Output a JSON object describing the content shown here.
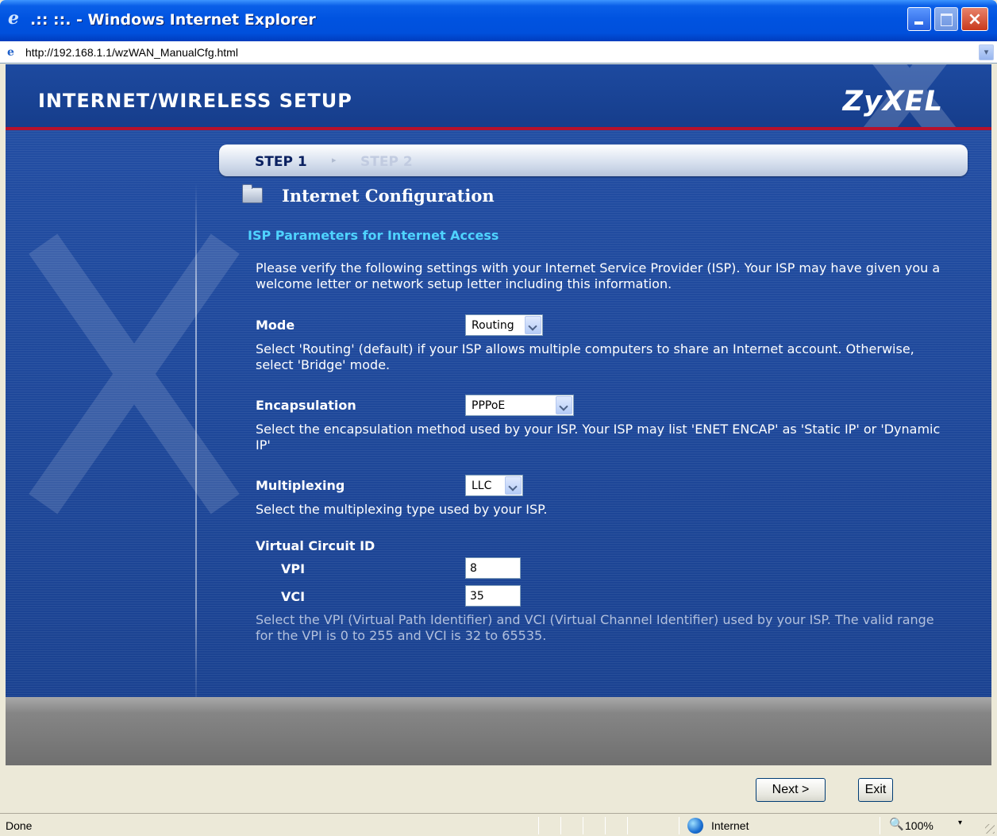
{
  "window": {
    "title": ".:: ::. - Windows Internet Explorer",
    "ie_icon": "ie-logo-icon",
    "controls": {
      "minimize": "minimize",
      "maximize": "maximize",
      "close": "×"
    }
  },
  "address": {
    "url": "http://192.168.1.1/wzWAN_ManualCfg.html",
    "icon": "page-icon"
  },
  "header": {
    "title": "INTERNET/WIRELESS SETUP",
    "brand": "ZyXEL",
    "accent_color": "#b5112c"
  },
  "steps": {
    "step1": "STEP 1",
    "arrow": "▸",
    "step2": "STEP 2"
  },
  "section": {
    "title": "Internet Configuration",
    "subtitle": "ISP Parameters for Internet Access",
    "intro": "Please verify the following settings with your Internet Service Provider (ISP). Your ISP may have given you a welcome letter or network setup letter including this information."
  },
  "mode": {
    "label": "Mode",
    "value": "Routing",
    "help": "Select 'Routing' (default) if your ISP allows multiple computers to share an Internet account. Otherwise, select 'Bridge' mode."
  },
  "encapsulation": {
    "label": "Encapsulation",
    "value": "PPPoE",
    "help": "Select the encapsulation method used by your ISP. Your ISP may list 'ENET ENCAP' as 'Static IP' or 'Dynamic IP'"
  },
  "multiplexing": {
    "label": "Multiplexing",
    "value": "LLC",
    "help": "Select the multiplexing type used by your ISP."
  },
  "vc": {
    "label": "Virtual Circuit ID",
    "vpi_label": "VPI",
    "vpi_value": "8",
    "vci_label": "VCI",
    "vci_value": "35",
    "help": "Select the VPI (Virtual Path Identifier) and VCI (Virtual Channel Identifier) used by your ISP. The valid range for the VPI is 0 to 255 and VCI is 32 to 65535."
  },
  "buttons": {
    "next": "Next >",
    "exit": "Exit"
  },
  "status": {
    "text": "Done",
    "zone": "Internet",
    "zoom": "100%",
    "zoom_arrow": "▾",
    "zoom_icon": "🔍"
  }
}
